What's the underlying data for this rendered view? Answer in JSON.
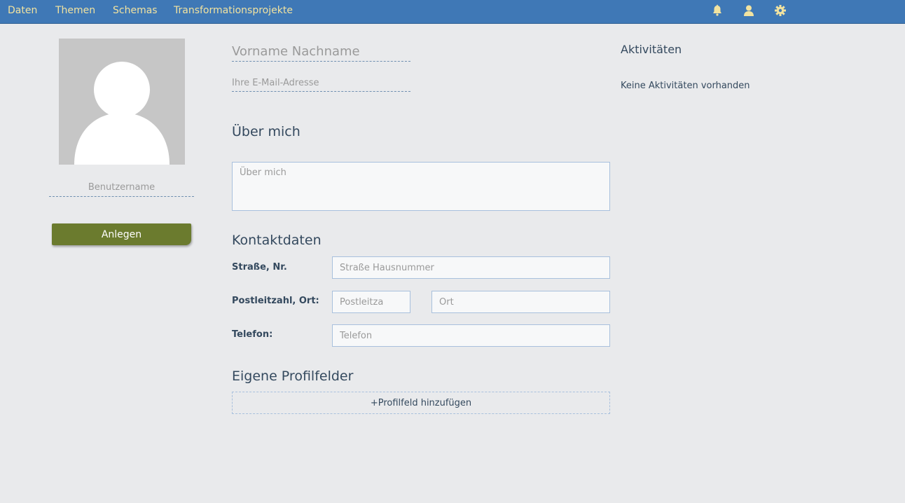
{
  "nav": {
    "items": [
      {
        "label": "Daten"
      },
      {
        "label": "Themen"
      },
      {
        "label": "Schemas"
      },
      {
        "label": "Transformationsprojekte"
      }
    ],
    "icons": [
      "bell-icon",
      "user-icon",
      "gear-icon"
    ],
    "bar_color": "#3f78b6",
    "link_color": "#f2e3a0"
  },
  "profile": {
    "username_placeholder": "Benutzername",
    "create_button": "Anlegen",
    "create_button_color": "#6b7b2e",
    "name_placeholder": "Vorname Nachname",
    "email_placeholder": "Ihre E-Mail-Adresse"
  },
  "about": {
    "heading": "Über mich",
    "placeholder": "Über mich"
  },
  "contact": {
    "heading": "Kontaktdaten",
    "street_label": "Straße, Nr.",
    "street_placeholder": "Straße Hausnummer",
    "zip_city_label": "Postleitzahl, Ort:",
    "zip_placeholder": "Postleitza",
    "city_placeholder": "Ort",
    "phone_label": "Telefon:",
    "phone_placeholder": "Telefon"
  },
  "custom_fields": {
    "heading": "Eigene Profilfelder",
    "add_button": "+Profilfeld hinzufügen"
  },
  "activities": {
    "title": "Aktivitäten",
    "empty_text": "Keine Aktivitäten vorhanden"
  }
}
